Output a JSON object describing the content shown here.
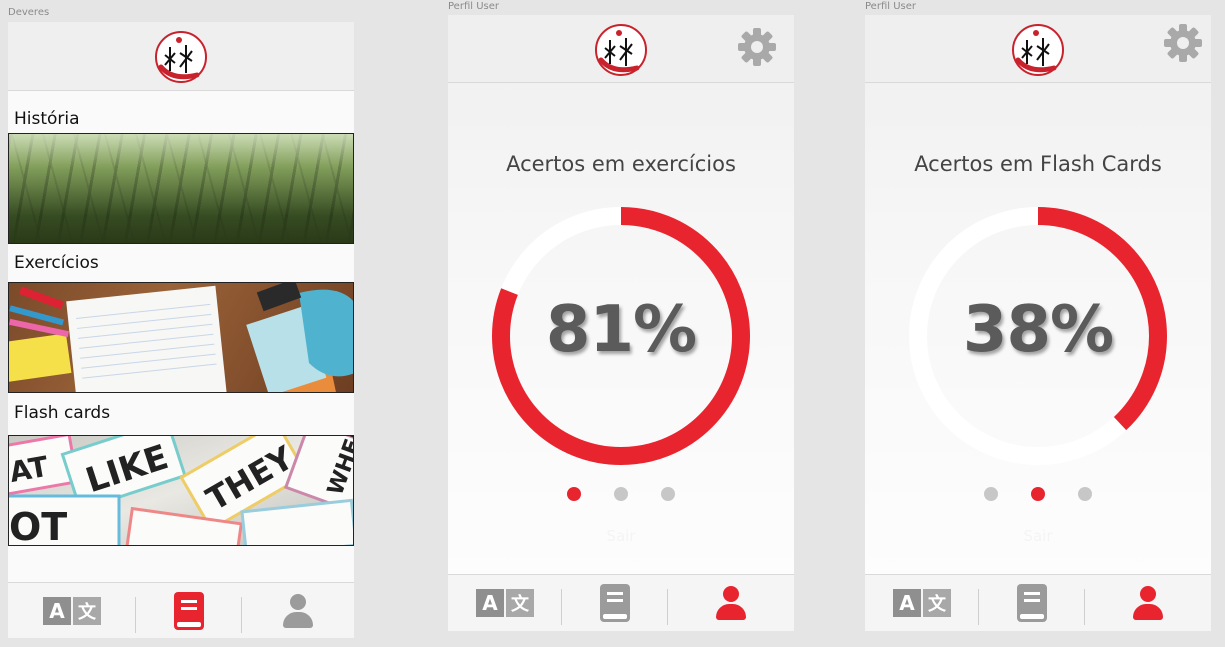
{
  "colors": {
    "accent": "#e8242f",
    "inactive": "#9b9b9b",
    "track": "#ffffff"
  },
  "artboards": [
    {
      "label": "Deveres",
      "sections": [
        {
          "title": "História",
          "image_icon": "forest-photo"
        },
        {
          "title": "Exercícios",
          "image_icon": "desk-notebook-photo"
        },
        {
          "title": "Flash cards",
          "image_icon": "word-cards-photo"
        }
      ],
      "flashcard_words": [
        "AT",
        "LIKE",
        "THEY",
        "WHERE",
        "OT"
      ],
      "nav": {
        "active": "book"
      }
    },
    {
      "label": "Perfil User",
      "stat_title": "Acertos em exercícios",
      "percent_text": "81%",
      "percent_value": 81,
      "active_dot": 0,
      "ghost_link": "Sair",
      "nav": {
        "active": "user"
      }
    },
    {
      "label": "Perfil User",
      "stat_title": "Acertos em Flash Cards",
      "percent_text": "38%",
      "percent_value": 38,
      "active_dot": 1,
      "ghost_link": "Sair",
      "nav": {
        "active": "user"
      }
    }
  ],
  "nav_items": [
    {
      "icon": "translate-icon",
      "glyph_a": "A",
      "glyph_b": "文"
    },
    {
      "icon": "book-icon"
    },
    {
      "icon": "user-icon"
    }
  ]
}
